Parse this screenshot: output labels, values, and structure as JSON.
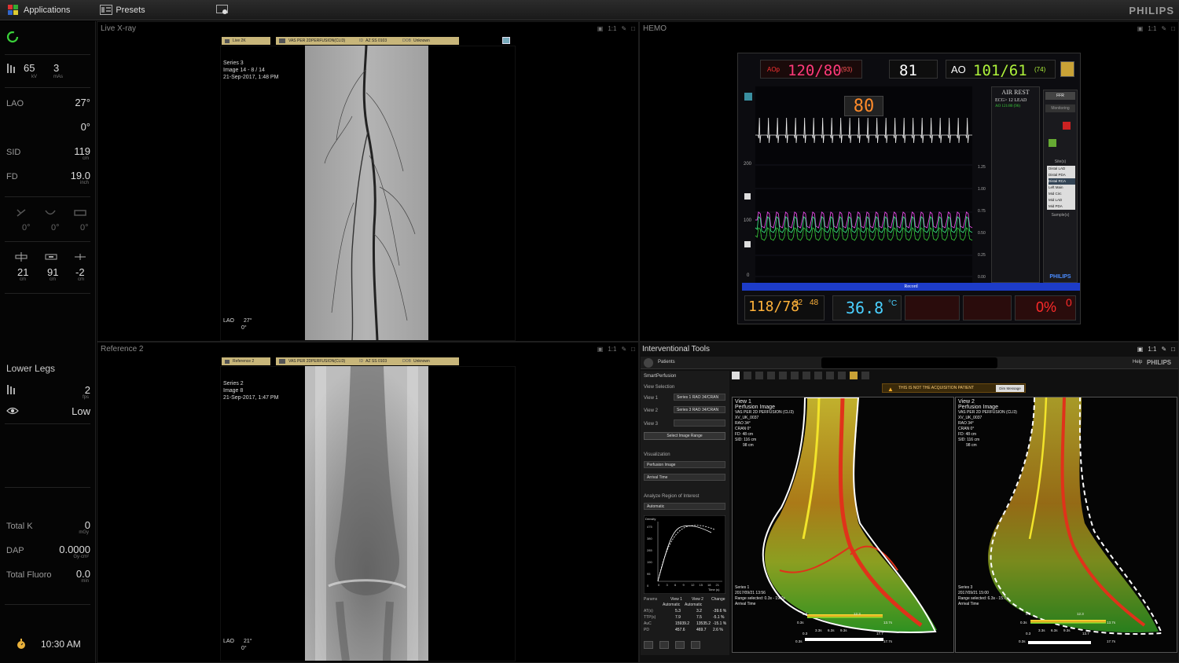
{
  "topbar": {
    "applications": "Applications",
    "presets": "Presets",
    "brand": "PHILIPS"
  },
  "sidebar": {
    "kv": "65",
    "kv_unit": "kV",
    "mas": "3",
    "mas_unit": "mAs",
    "lao_label": "LAO",
    "lao_val": "27°",
    "cran_val": "0°",
    "sid_label": "SID",
    "sid_val": "119",
    "sid_unit": "cm",
    "fd_label": "FD",
    "fd_val": "19.0",
    "fd_unit": "inch",
    "angle1": "0°",
    "angle2": "0°",
    "angle3": "0°",
    "pos1": "21",
    "pos2": "91",
    "pos3": "-2",
    "pos_unit": "cm",
    "protocol": "Lower Legs",
    "fps": "2",
    "fps_unit": "fps",
    "dose": "Low",
    "totalk_label": "Total K",
    "totalk_val": "0",
    "totalk_unit": "mGy",
    "dap_label": "DAP",
    "dap_val": "0.0000",
    "dap_unit": "Gy·cm²",
    "fluoro_label": "Total Fluoro",
    "fluoro_val": "0.0",
    "fluoro_unit": "min",
    "time": "10:30 AM"
  },
  "live": {
    "title": "Live X-ray",
    "ratio": "1:1",
    "tab1": "Live 2K",
    "tab2": "VAS PER 2DPERFUSION(CLI3)",
    "id_label": "ID",
    "id": "AZ SS 0103",
    "dob_label": "DOB",
    "dob": "Unknown",
    "series": "Series 3",
    "image": "Image 14 - 8 / 14",
    "date": "21-Sep-2017, 1:48 PM",
    "lao": "LAO",
    "lao_val": "27°",
    "cran": "0°"
  },
  "ref": {
    "title": "Reference 2",
    "ratio": "1:1",
    "tab1": "Reference 2",
    "tab2": "VAS PER 2DPERFUSION(CLI3)",
    "id_label": "ID",
    "id": "AZ SS 0103",
    "dob_label": "DOB",
    "dob": "Unknown",
    "series": "Series 2",
    "image": "Image 8",
    "date": "21-Sep-2017, 1:47 PM",
    "lao": "LAO",
    "lao_val": "21°",
    "cran": "0°"
  },
  "hemo": {
    "title": "HEMO",
    "ratio": "1:1",
    "aop_label": "AOp",
    "aop": "120/80",
    "aop_mean": "(93)",
    "hr": "81",
    "ao_label": "AO",
    "ao": "101/61",
    "ao_mean": "(74)",
    "hr_big": "80",
    "air_rest": "AIR REST",
    "ecg": "ECG> 12 LEAD",
    "ao_small": "AO 121/80 (96)",
    "ffr": "FFR",
    "monitoring": "Monitoring",
    "y200": "200",
    "y100": "100",
    "y0": "0",
    "r125": "1.25",
    "r100": "1.00",
    "r075": "0.75",
    "r050": "0.50",
    "r025": "0.25",
    "r000": "0.00",
    "sites_label": "Site(s)",
    "sites": [
      "Distal LAD",
      "Distal PDA",
      "Distal RCA",
      "Left Main",
      "Mid Circ",
      "Mid LAD",
      "Mid PDA"
    ],
    "samples": "Sample(s)",
    "record": "Record",
    "nibp": "118/78",
    "nibp_mean": "92",
    "spo2": "48",
    "temp": "36.8",
    "temp_unit": "°C",
    "pct": "0%",
    "pct2": "0",
    "brand": "PHILIPS"
  },
  "it": {
    "title": "Interventional Tools",
    "ratio": "1:1",
    "patients": "Patients",
    "help": "Help",
    "brand": "PHILIPS",
    "app": "SmartPerfusion",
    "view_sel": "View Selection",
    "view1": "View 1",
    "view1_val": "Series 1 RAO 34/CRAN",
    "view2": "View 2",
    "view2_val": "Series 3 RAO 34/CRAN",
    "view3": "View 3",
    "select_range": "Select Image Range",
    "visualization": "Visualization",
    "vis1": "Perfusion Image",
    "vis2": "Arrival Time",
    "roi": "Analyze Region of Interest",
    "roi_val": "Automatic",
    "density": "Density",
    "time_s": "Time (s)",
    "y_ticks": [
      "475",
      "380",
      "285",
      "190",
      "95",
      "0"
    ],
    "x_ticks": [
      "0",
      "3",
      "6",
      "9",
      "12",
      "15",
      "18",
      "21"
    ],
    "params": "Params",
    "col1": "View 1",
    "col2": "View 2",
    "col3": "Change",
    "auto1": "Automatic",
    "auto2": "Automatic",
    "rows": [
      [
        "AT(s)",
        "5.3",
        "3.2",
        "-39.6 %"
      ],
      [
        "TTP(s)",
        "7.9",
        "7.5",
        "-5.1 %"
      ],
      [
        "AuC",
        "15939.2",
        "13535.2",
        "-15.1 %"
      ],
      [
        "PD",
        "457.6",
        "469.7",
        "2.6 %"
      ]
    ],
    "warning": "THIS IS NOT THE ACQUISITION PATIENT",
    "dim": "Dim Message",
    "v1": {
      "name": "View 1",
      "type": "Perfusion Image",
      "study": "VAS PER 2D PERFUSION (CLI3)",
      "pid": "XV_UK_0037",
      "rao": "RAO 34°",
      "cran": "CRAN 0°",
      "fd": "FD: 48 cm",
      "sid": "SID: 116 cm",
      "scale": "98 cm",
      "series": "Series 1",
      "date": "2017/09/21 13:56",
      "range": "Range selected: 0.3s - 19.7s",
      "mode": "Arrival Time",
      "c1": "0.3",
      "c2": "12.3",
      "c3": "0.3s",
      "c4": "3.3s",
      "c5": "6.3s",
      "c6": "9.3s",
      "c7": "13.7s",
      "c8": "0.3",
      "c9": "17.7",
      "c10": "0.3s",
      "c11": "17.7s"
    },
    "v2": {
      "name": "View 2",
      "type": "Perfusion Image",
      "study": "VAS PER 2D PERFUSION (CLI3)",
      "pid": "XV_UK_0037",
      "rao": "RAO 34°",
      "cran": "CRAN 0°",
      "fd": "FD: 48 cm",
      "sid": "SID: 116 cm",
      "scale": "98 cm",
      "series": "Series 3",
      "date": "2017/09/21 15:00",
      "range": "Range selected: 6.3s - 15.7s",
      "mode": "Arrival Time",
      "c1": "0.3",
      "c2": "12.3",
      "c3": "0.3s",
      "c4": "3.3s",
      "c5": "6.3s",
      "c6": "9.3s",
      "c7": "13.7s",
      "c8": "0.3",
      "c9": "13.7",
      "c10": "0.3s",
      "c11": "17.7s"
    }
  },
  "colors": {
    "accent_green": "#3ad13a",
    "panel_border": "#1e1e1e",
    "record_blue": "#1d3cc8",
    "monitor_red": "#ff2a2a",
    "warning_orange": "#d28c14"
  }
}
